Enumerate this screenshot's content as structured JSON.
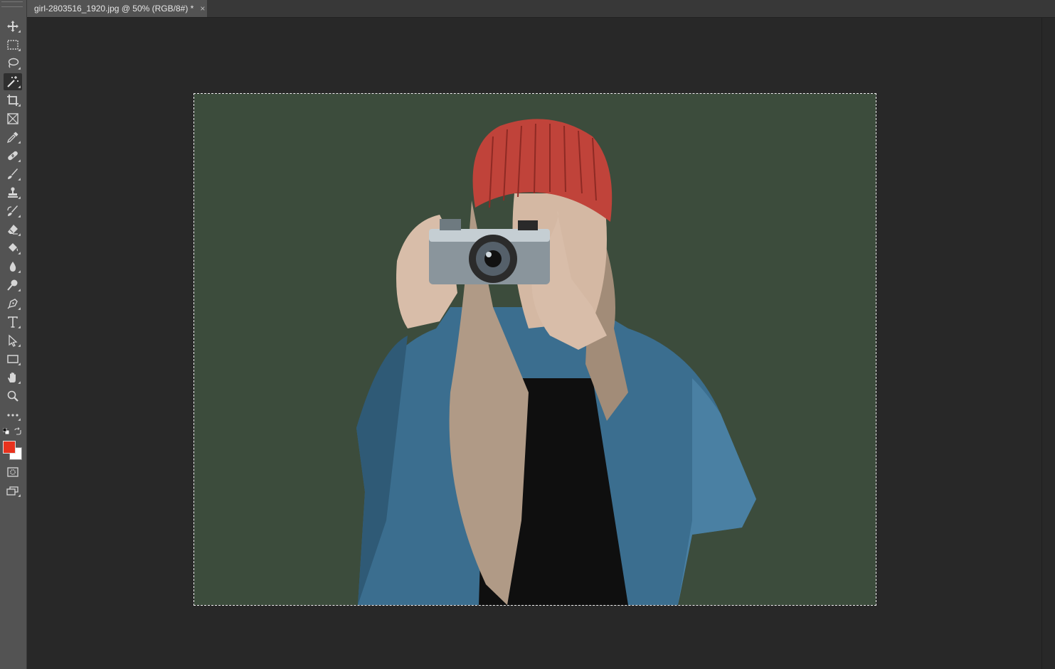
{
  "document_tab": {
    "title": "girl-2803516_1920.jpg @ 50% (RGB/8#) *",
    "close_glyph": "×"
  },
  "toolbar": {
    "tools": [
      {
        "name": "move-tool",
        "icon": "move-icon"
      },
      {
        "name": "rectangular-marquee-tool",
        "icon": "marquee-icon"
      },
      {
        "name": "lasso-tool",
        "icon": "lasso-icon"
      },
      {
        "name": "magic-wand-tool",
        "icon": "magic-wand-icon",
        "active": true
      },
      {
        "name": "crop-tool",
        "icon": "crop-icon"
      },
      {
        "name": "frame-tool",
        "icon": "frame-icon"
      },
      {
        "name": "eyedropper-tool",
        "icon": "eyedropper-icon"
      },
      {
        "name": "healing-brush-tool",
        "icon": "bandage-icon"
      },
      {
        "name": "brush-tool",
        "icon": "brush-icon"
      },
      {
        "name": "clone-stamp-tool",
        "icon": "stamp-icon"
      },
      {
        "name": "history-brush-tool",
        "icon": "history-brush-icon"
      },
      {
        "name": "eraser-tool",
        "icon": "eraser-icon"
      },
      {
        "name": "paint-bucket-tool",
        "icon": "paint-bucket-icon"
      },
      {
        "name": "blur-tool",
        "icon": "drop-icon"
      },
      {
        "name": "dodge-tool",
        "icon": "dodge-icon"
      },
      {
        "name": "pen-tool",
        "icon": "pen-icon"
      },
      {
        "name": "type-tool",
        "icon": "type-icon"
      },
      {
        "name": "path-selection-tool",
        "icon": "arrow-icon"
      },
      {
        "name": "rectangle-tool",
        "icon": "rectangle-icon"
      },
      {
        "name": "hand-tool",
        "icon": "hand-icon"
      },
      {
        "name": "zoom-tool",
        "icon": "zoom-icon"
      },
      {
        "name": "edit-toolbar",
        "icon": "more-icon"
      }
    ],
    "foreground_color": "#e8321e",
    "background_color": "#ffffff",
    "quick_mask_icon": "quick-mask-icon",
    "screen_mode_icon": "screen-mode-icon"
  },
  "canvas": {
    "background_color": "#3c4c3c",
    "pasteboard_color": "#282828"
  }
}
